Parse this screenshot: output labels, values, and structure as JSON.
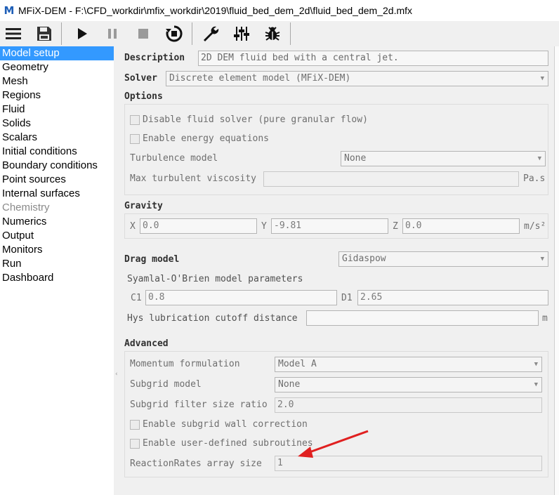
{
  "window": {
    "logo_letter": "M",
    "title": "MFiX-DEM - F:\\CFD_workdir\\mfix_workdir\\2019\\fluid_bed_dem_2d\\fluid_bed_dem_2d.mfx"
  },
  "toolbar": {
    "icons": [
      "menu-icon",
      "save-icon",
      "run-icon",
      "pause-icon",
      "stop-icon",
      "reset-icon",
      "settings-wrench-icon",
      "sliders-icon",
      "debug-bug-icon"
    ]
  },
  "sidebar": {
    "items": [
      {
        "label": "Model setup",
        "state": "active"
      },
      {
        "label": "Geometry",
        "state": "normal"
      },
      {
        "label": "Mesh",
        "state": "normal"
      },
      {
        "label": "Regions",
        "state": "normal"
      },
      {
        "label": "Fluid",
        "state": "normal"
      },
      {
        "label": "Solids",
        "state": "normal"
      },
      {
        "label": "Scalars",
        "state": "normal"
      },
      {
        "label": "Initial conditions",
        "state": "normal"
      },
      {
        "label": "Boundary conditions",
        "state": "normal"
      },
      {
        "label": "Point sources",
        "state": "normal"
      },
      {
        "label": "Internal surfaces",
        "state": "normal"
      },
      {
        "label": "Chemistry",
        "state": "disabled"
      },
      {
        "label": "Numerics",
        "state": "normal"
      },
      {
        "label": "Output",
        "state": "normal"
      },
      {
        "label": "Monitors",
        "state": "normal"
      },
      {
        "label": "Run",
        "state": "normal"
      },
      {
        "label": "Dashboard",
        "state": "normal"
      }
    ]
  },
  "model": {
    "description_label": "Description",
    "description_value": "2D DEM fluid bed with a central jet.",
    "solver_label": "Solver",
    "solver_value": "Discrete element model (MFiX-DEM)"
  },
  "options": {
    "heading": "Options",
    "disable_fluid_solver": "Disable fluid solver (pure granular flow)",
    "enable_energy": "Enable energy equations",
    "turbulence_label": "Turbulence model",
    "turbulence_value": "None",
    "max_visc_label": "Max turbulent viscosity",
    "max_visc_value": "",
    "max_visc_unit": "Pa.s"
  },
  "gravity": {
    "heading": "Gravity",
    "x_label": "X",
    "x_value": "0.0",
    "y_label": "Y",
    "y_value": "-9.81",
    "z_label": "Z",
    "z_value": "0.0",
    "unit": "m/s²"
  },
  "drag": {
    "heading": "Drag model",
    "value": "Gidaspow",
    "syamlal_label": "Syamlal-O'Brien model parameters",
    "c1_label": "C1",
    "c1_value": "0.8",
    "d1_label": "D1",
    "d1_value": "2.65",
    "hys_label": "Hys lubrication cutoff distance",
    "hys_value": "",
    "hys_unit": "m"
  },
  "advanced": {
    "heading": "Advanced",
    "momentum_label": "Momentum formulation",
    "momentum_value": "Model A",
    "subgrid_label": "Subgrid model",
    "subgrid_value": "None",
    "filter_label": "Subgrid filter size ratio",
    "filter_value": "2.0",
    "wall_corr": "Enable subgrid wall correction",
    "user_sub": "Enable user-defined subroutines",
    "rr_label": "ReactionRates array size",
    "rr_value": "1"
  },
  "annotation": {
    "arrow_color": "#e02020"
  }
}
